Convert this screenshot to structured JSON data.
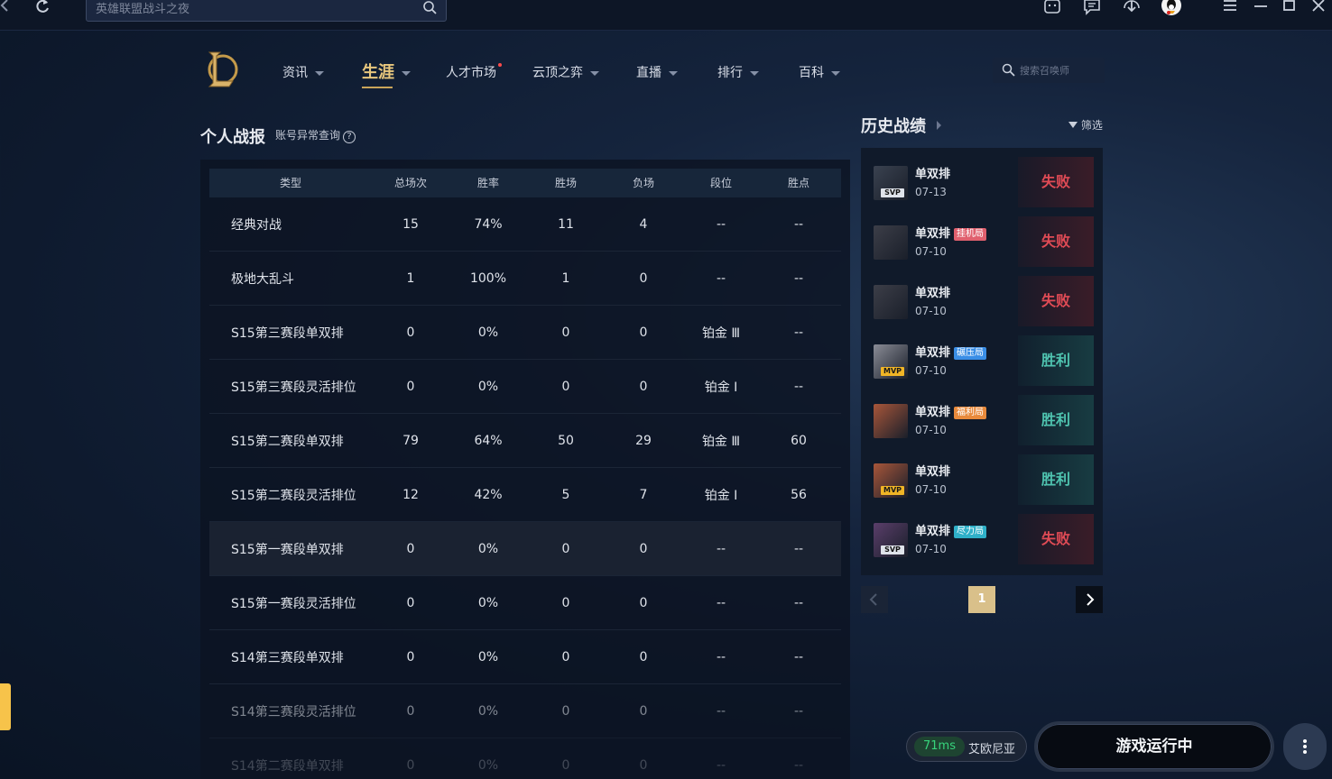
{
  "topbar": {
    "search_placeholder": "英雄联盟战斗之夜"
  },
  "nav": {
    "items": [
      {
        "label": "资讯"
      },
      {
        "label": "生涯"
      },
      {
        "label": "人才市场"
      },
      {
        "label": "云顶之弈"
      },
      {
        "label": "直播"
      },
      {
        "label": "排行"
      },
      {
        "label": "百科"
      }
    ],
    "summoner_search_placeholder": "搜索召唤师"
  },
  "personal": {
    "title": "个人战报",
    "account_check": "账号异常查询",
    "columns": [
      "类型",
      "总场次",
      "胜率",
      "胜场",
      "负场",
      "段位",
      "胜点"
    ],
    "rows": [
      [
        "经典对战",
        "15",
        "74%",
        "11",
        "4",
        "--",
        "--"
      ],
      [
        "极地大乱斗",
        "1",
        "100%",
        "1",
        "0",
        "--",
        "--"
      ],
      [
        "S15第三赛段单双排",
        "0",
        "0%",
        "0",
        "0",
        "铂金 Ⅲ",
        "--"
      ],
      [
        "S15第三赛段灵活排位",
        "0",
        "0%",
        "0",
        "0",
        "铂金 Ⅰ",
        "--"
      ],
      [
        "S15第二赛段单双排",
        "79",
        "64%",
        "50",
        "29",
        "铂金 Ⅲ",
        "60"
      ],
      [
        "S15第二赛段灵活排位",
        "12",
        "42%",
        "5",
        "7",
        "铂金 Ⅰ",
        "56"
      ],
      [
        "S15第一赛段单双排",
        "0",
        "0%",
        "0",
        "0",
        "--",
        "--"
      ],
      [
        "S15第一赛段灵活排位",
        "0",
        "0%",
        "0",
        "0",
        "--",
        "--"
      ],
      [
        "S14第三赛段单双排",
        "0",
        "0%",
        "0",
        "0",
        "--",
        "--"
      ],
      [
        "S14第三赛段灵活排位",
        "0",
        "0%",
        "0",
        "0",
        "--",
        "--"
      ],
      [
        "S14第二赛段单双排",
        "0",
        "0%",
        "0",
        "0",
        "--",
        "--"
      ]
    ]
  },
  "history": {
    "title": "历史战绩",
    "filter_label": "筛选",
    "matches": [
      {
        "mode": "单双排",
        "tag": "",
        "tag_color": "",
        "date": "07-13",
        "result": "失败",
        "badge": "SVP",
        "avatar_color": "#3a4250"
      },
      {
        "mode": "单双排",
        "tag": "挂机局",
        "tag_color": "#e0606e",
        "date": "07-10",
        "result": "失败",
        "badge": "",
        "avatar_color": "#3c3e48"
      },
      {
        "mode": "单双排",
        "tag": "",
        "tag_color": "",
        "date": "07-10",
        "result": "失败",
        "badge": "",
        "avatar_color": "#3c3e48"
      },
      {
        "mode": "单双排",
        "tag": "碾压局",
        "tag_color": "#3a8ee6",
        "date": "07-10",
        "result": "胜利",
        "badge": "MVP",
        "avatar_color": "#8a8c96"
      },
      {
        "mode": "单双排",
        "tag": "福利局",
        "tag_color": "#e88a3c",
        "date": "07-10",
        "result": "胜利",
        "badge": "",
        "avatar_color": "#a8563a"
      },
      {
        "mode": "单双排",
        "tag": "",
        "tag_color": "",
        "date": "07-10",
        "result": "胜利",
        "badge": "MVP",
        "avatar_color": "#a8563a"
      },
      {
        "mode": "单双排",
        "tag": "尽力局",
        "tag_color": "#2fb0c8",
        "date": "07-10",
        "result": "失败",
        "badge": "SVP",
        "avatar_color": "#5a3e6a"
      }
    ],
    "page": "1"
  },
  "footer": {
    "ping": "71ms",
    "server": "艾欧尼亚",
    "game_status": "游戏运行中"
  }
}
